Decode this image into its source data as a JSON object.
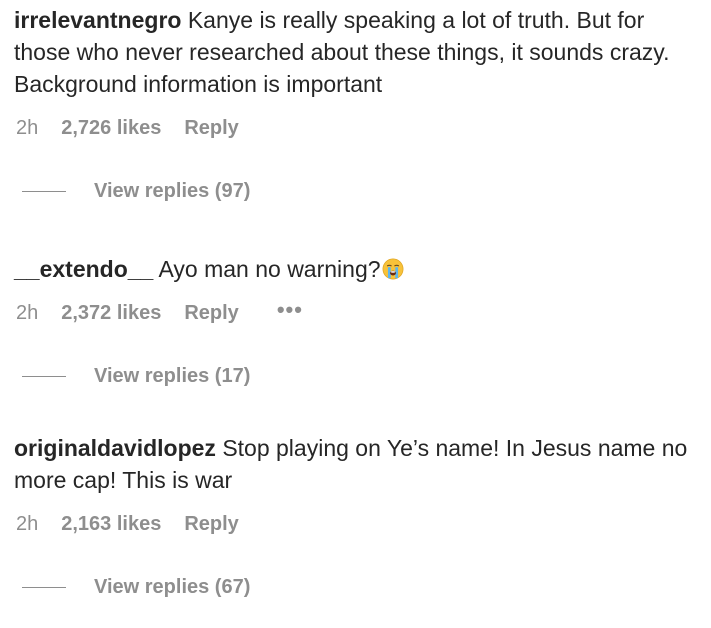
{
  "comments": [
    {
      "username": "irrelevantnegro",
      "text": "Kanye is really speaking a lot of truth. But for those who never researched about these things, it sounds crazy. Background information is important",
      "time": "2h",
      "likes": "2,726 likes",
      "reply_label": "Reply",
      "view_replies": "View replies (97)"
    },
    {
      "username": "__extendo__",
      "text": "Ayo man no warning?",
      "emoji": "loudly-crying-face-icon",
      "time": "2h",
      "likes": "2,372 likes",
      "reply_label": "Reply",
      "more_label": "•••",
      "view_replies": "View replies (17)"
    },
    {
      "username": "originaldavidlopez",
      "text": "Stop playing on Ye’s name! In Jesus name no more cap! This is war",
      "time": "2h",
      "likes": "2,163 likes",
      "reply_label": "Reply",
      "view_replies": "View replies (67)"
    }
  ],
  "colors": {
    "text_primary": "#262626",
    "text_secondary": "#8e8e8e"
  }
}
